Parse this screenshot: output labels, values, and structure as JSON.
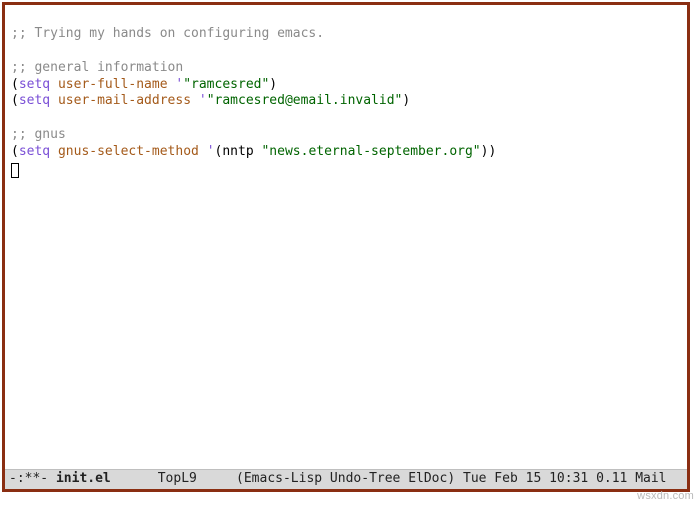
{
  "code": {
    "c1": ";; Trying my hands on configuring emacs.",
    "c2": ";; general information",
    "l3": {
      "kw": "setq",
      "var": "user-full-name",
      "q": "'",
      "str": "\"ramcesred\""
    },
    "l4": {
      "kw": "setq",
      "var": "user-mail-address",
      "q": "'",
      "str": "\"ramcesred@email.invalid\""
    },
    "c5": ";; gnus",
    "l6": {
      "kw": "setq",
      "var": "gnus-select-method",
      "q": "'",
      "sym": "nntp",
      "str": "\"news.eternal-september.org\""
    }
  },
  "modeline": {
    "left_flags": "-:**- ",
    "buffer": "init.el",
    "gap1": "      ",
    "pos": "Top",
    "line": "L9",
    "gap2": "     ",
    "modes_open": "(",
    "modes": "Emacs-Lisp Undo-Tree ElDoc",
    "modes_close": ")",
    "datetime": " Tue Feb 15 10:31 ",
    "load": "0.11",
    "tail": " Mail"
  },
  "watermark": "wsxdn.com"
}
